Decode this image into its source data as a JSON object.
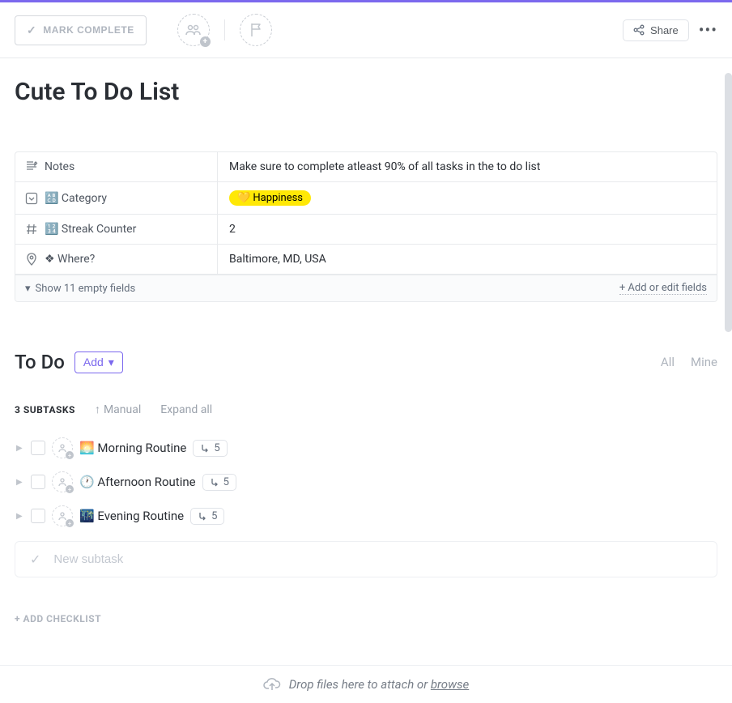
{
  "toolbar": {
    "mark_complete_label": "MARK COMPLETE",
    "share_label": "Share"
  },
  "page_title": "Cute To Do List",
  "properties": [
    {
      "icon": "notes",
      "label": "Notes",
      "value": "Make sure to complete atleast 90% of all tasks in the to do list"
    },
    {
      "icon": "select",
      "label": "🔠 Category",
      "value_tag": "💛 Happiness"
    },
    {
      "icon": "hash",
      "label": "🔢 Streak Counter",
      "value": "2"
    },
    {
      "icon": "location",
      "label": "❖ Where?",
      "value": "Baltimore, MD, USA"
    }
  ],
  "props_footer": {
    "show_empty": "Show 11 empty fields",
    "add_edit": "+ Add or edit fields"
  },
  "section": {
    "title": "To Do",
    "add_label": "Add",
    "filter_all": "All",
    "filter_mine": "Mine"
  },
  "subtask_meta": {
    "count_label": "3 SUBTASKS",
    "sort_label": "Manual",
    "expand_label": "Expand all"
  },
  "subtasks": [
    {
      "emoji": "🌅",
      "name": "Morning Routine",
      "count": "5"
    },
    {
      "emoji": "🕐",
      "name": "Afternoon Routine",
      "count": "5"
    },
    {
      "emoji": "🌃",
      "name": "Evening Routine",
      "count": "5"
    }
  ],
  "new_subtask_placeholder": "New subtask",
  "add_checklist_label": "+ ADD CHECKLIST",
  "drop_bar": {
    "text": "Drop files here to attach or ",
    "browse": "browse"
  }
}
